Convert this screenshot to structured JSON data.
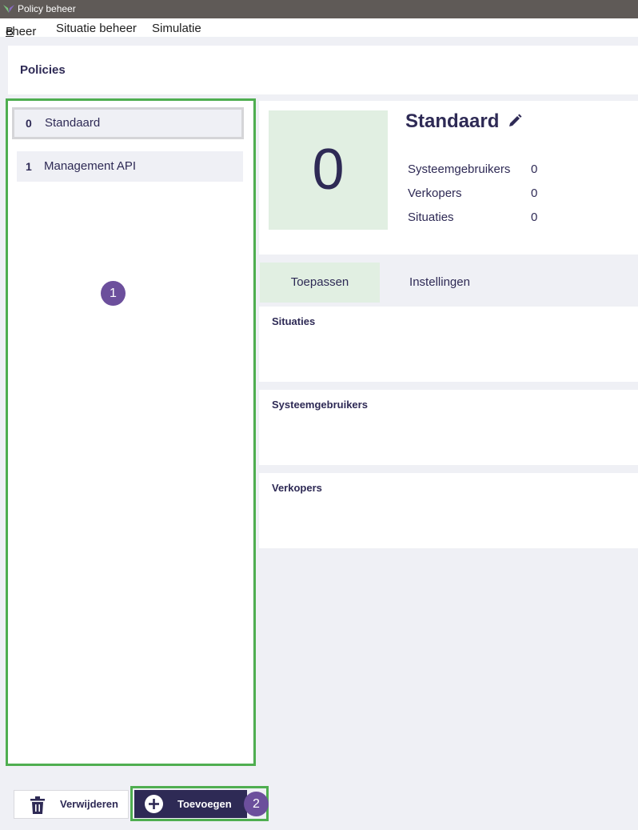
{
  "window": {
    "title": "Policy beheer"
  },
  "menu": {
    "beheer": "Beheer",
    "situatie_beheer": "Situatie beheer",
    "simulatie": "Simulatie"
  },
  "header": {
    "title": "Policies"
  },
  "policies": [
    {
      "number": "0",
      "name": "Standaard"
    },
    {
      "number": "1",
      "name": "Management API"
    }
  ],
  "annotations": {
    "badge1": "1",
    "badge2": "2"
  },
  "buttons": {
    "delete": "Verwijderen",
    "add": "Toevoegen"
  },
  "detail": {
    "tile_number": "0",
    "name": "Standaard",
    "stats": [
      {
        "label": "Systeemgebruikers",
        "value": "0"
      },
      {
        "label": "Verkopers",
        "value": "0"
      },
      {
        "label": "Situaties",
        "value": "0"
      }
    ],
    "tabs": [
      {
        "label": "Toepassen"
      },
      {
        "label": "Instellingen"
      }
    ],
    "sections": [
      {
        "title": "Situaties"
      },
      {
        "title": "Systeemgebruikers"
      },
      {
        "title": "Verkopers"
      }
    ]
  },
  "colors": {
    "primary": "#2e2a55",
    "highlight_green": "#4fae50",
    "tile_bg": "#e1efe2",
    "badge": "#6c4f9c",
    "background": "#eff0f5"
  }
}
